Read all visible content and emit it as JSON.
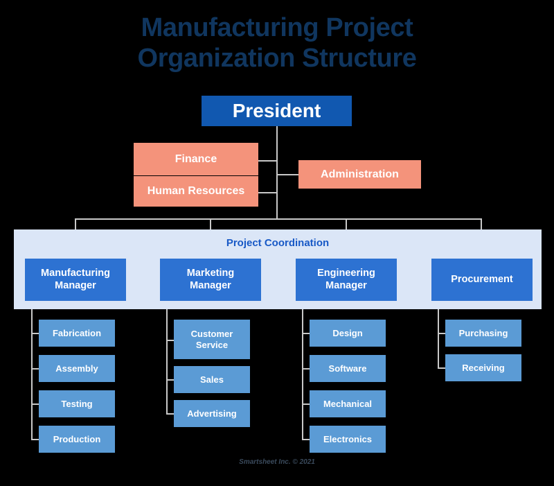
{
  "title": {
    "line1": "Manufacturing Project",
    "line2": "Organization Structure"
  },
  "colors": {
    "background": "#000000",
    "title_text": "#10365F",
    "president_box": "#1158B0",
    "support_box": "#F4937B",
    "manager_box": "#2D72D2",
    "leaf_box": "#5B9BD5",
    "coordination_band": "#DBE6F7",
    "coordination_text": "#1859C6",
    "connector_line": "#C9C9C9",
    "box_text": "#FFFFFF",
    "footer_text": "#3A4A5C"
  },
  "president": {
    "label": "President"
  },
  "support_units": [
    {
      "label": "Finance"
    },
    {
      "label": "Human Resources"
    },
    {
      "label": "Administration"
    }
  ],
  "coordination": {
    "label": "Project Coordination"
  },
  "departments": [
    {
      "manager": "Manufacturing\nManager",
      "manager_line1": "Manufacturing",
      "manager_line2": "Manager",
      "units": [
        {
          "label": "Fabrication"
        },
        {
          "label": "Assembly"
        },
        {
          "label": "Testing"
        },
        {
          "label": "Production"
        }
      ]
    },
    {
      "manager": "Marketing\nManager",
      "manager_line1": "Marketing",
      "manager_line2": "Manager",
      "units": [
        {
          "label": "Customer\nService",
          "line1": "Customer",
          "line2": "Service"
        },
        {
          "label": "Sales"
        },
        {
          "label": "Advertising"
        }
      ]
    },
    {
      "manager": "Engineering\nManager",
      "manager_line1": "Engineering",
      "manager_line2": "Manager",
      "units": [
        {
          "label": "Design"
        },
        {
          "label": "Software"
        },
        {
          "label": "Mechanical"
        },
        {
          "label": "Electronics"
        }
      ]
    },
    {
      "manager": "Procurement",
      "manager_line1": "Procurement",
      "manager_line2": "",
      "units": [
        {
          "label": "Purchasing"
        },
        {
          "label": "Receiving"
        }
      ]
    }
  ],
  "footer": {
    "credit": "Smartsheet Inc. © 2021"
  }
}
